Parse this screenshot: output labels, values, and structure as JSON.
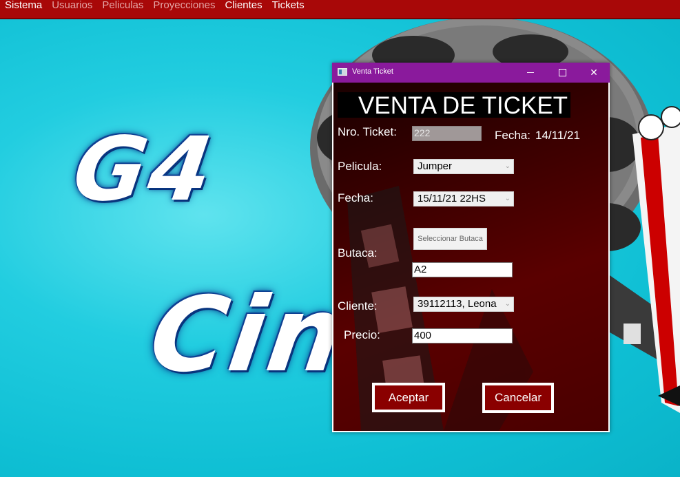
{
  "menu": {
    "items": [
      {
        "label": "Sistema",
        "enabled": true
      },
      {
        "label": "Usuarios",
        "enabled": false
      },
      {
        "label": "Peliculas",
        "enabled": false
      },
      {
        "label": "Proyecciones",
        "enabled": false
      },
      {
        "label": "Clientes",
        "enabled": true
      },
      {
        "label": "Tickets",
        "enabled": true
      }
    ]
  },
  "background": {
    "brand_top": "G4",
    "brand_bottom": "Cine"
  },
  "window": {
    "title": "Venta Ticket",
    "titlebar_color": "#8a1a9c",
    "header": "VENTA DE TICKET",
    "ticket": {
      "label": "Nro. Ticket:",
      "value": "222"
    },
    "fecha_venta": {
      "label": "Fecha:",
      "value": "14/11/21"
    },
    "pelicula": {
      "label": "Pelicula:",
      "value": "Jumper"
    },
    "funcion": {
      "label": "Fecha:",
      "value": "15/11/21 22HS"
    },
    "butaca": {
      "label": "Butaca:",
      "button": "Seleccionar Butaca",
      "value": "A2"
    },
    "cliente": {
      "label": "Cliente:",
      "value": "39112113, Leona"
    },
    "precio": {
      "label": "Precio:",
      "value": "400"
    },
    "actions": {
      "accept": "Aceptar",
      "cancel": "Cancelar"
    }
  }
}
